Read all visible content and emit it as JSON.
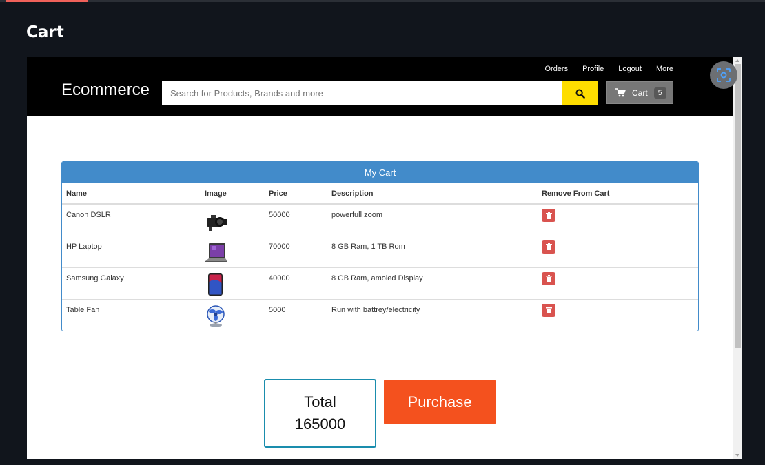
{
  "page": {
    "title": "Cart"
  },
  "navbar": {
    "brand": "Ecommerce",
    "links": [
      "Orders",
      "Profile",
      "Logout",
      "More"
    ],
    "search_placeholder": "Search for Products, Brands and more",
    "cart_label": "Cart",
    "cart_count": "5"
  },
  "cart": {
    "heading": "My Cart",
    "columns": [
      "Name",
      "Image",
      "Price",
      "Description",
      "Remove From Cart"
    ],
    "rows": [
      {
        "name": "Canon DSLR",
        "price": "50000",
        "description": "powerfull zoom",
        "image_icon": "camera-icon"
      },
      {
        "name": "HP Laptop",
        "price": "70000",
        "description": "8 GB Ram, 1 TB Rom",
        "image_icon": "laptop-icon"
      },
      {
        "name": "Samsung Galaxy",
        "price": "40000",
        "description": "8 GB Ram, amoled Display",
        "image_icon": "phone-icon"
      },
      {
        "name": "Table Fan",
        "price": "5000",
        "description": "Run with battrey/electricity",
        "image_icon": "fan-icon"
      }
    ]
  },
  "summary": {
    "total_label": "Total",
    "total_value": "165000",
    "purchase_label": "Purchase"
  },
  "colors": {
    "navbar": "#000000",
    "search_button": "#fedd00",
    "panel_header": "#428bca",
    "delete_button": "#d9534f",
    "purchase_button": "#f4511e",
    "total_border": "#1a8dad"
  }
}
